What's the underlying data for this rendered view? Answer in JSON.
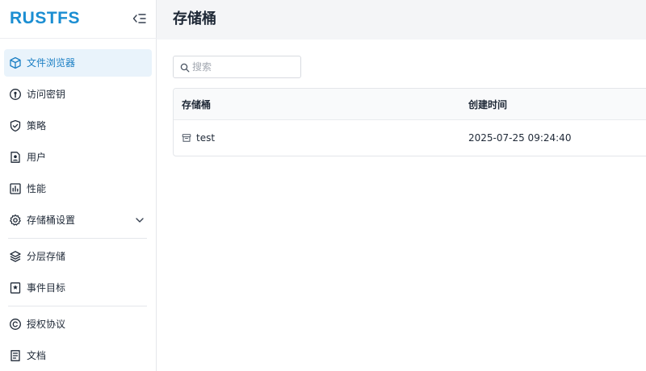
{
  "app": {
    "logo": "RUSTFS"
  },
  "sidebar": {
    "items": [
      {
        "label": "文件浏览器",
        "icon": "cube-icon",
        "active": true
      },
      {
        "label": "访问密钥",
        "icon": "key-circle-icon"
      },
      {
        "label": "策略",
        "icon": "shield-check-icon"
      },
      {
        "label": "用户",
        "icon": "user-file-icon"
      },
      {
        "label": "性能",
        "icon": "bar-chart-icon"
      },
      {
        "label": "存储桶设置",
        "icon": "gear-icon",
        "expandable": true
      },
      {
        "label": "分层存储",
        "icon": "layers-icon"
      },
      {
        "label": "事件目标",
        "icon": "bookmark-star-icon"
      },
      {
        "label": "授权协议",
        "icon": "copyright-icon"
      },
      {
        "label": "文档",
        "icon": "document-icon"
      }
    ]
  },
  "header": {
    "title": "存储桶"
  },
  "search": {
    "placeholder": "搜索",
    "value": ""
  },
  "table": {
    "columns": [
      "存储桶",
      "创建时间"
    ],
    "rows": [
      {
        "name": "test",
        "created": "2025-07-25 09:24:40"
      }
    ]
  },
  "colors": {
    "brand": "#1b8ed2",
    "active_bg": "#e9f3fb",
    "active_text": "#1b7fc4"
  }
}
